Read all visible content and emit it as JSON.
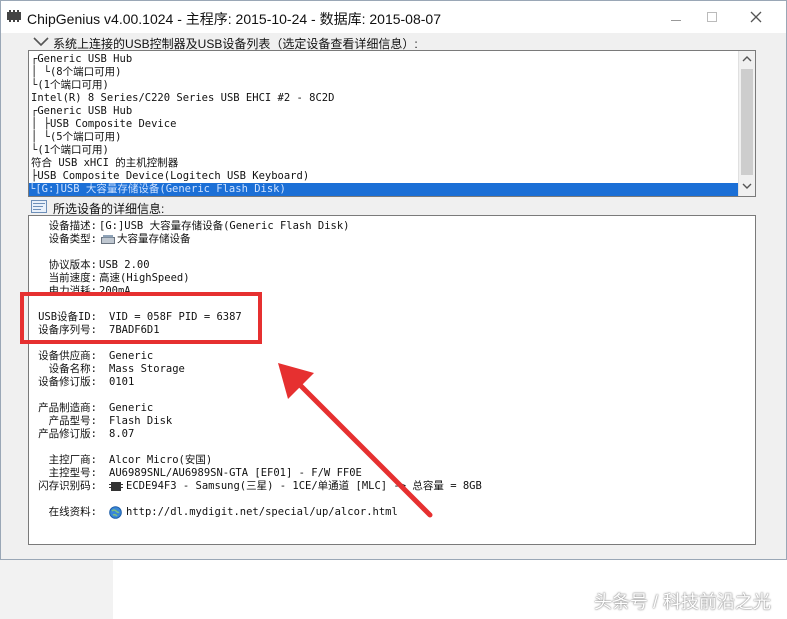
{
  "window": {
    "title": "ChipGenius v4.00.1024 - 主程序: 2015-10-24 - 数据库: 2015-08-07"
  },
  "device_list_section": {
    "label": "系统上连接的USB控制器及USB设备列表（选定设备查看详细信息）:",
    "items": [
      "┌Generic USB Hub",
      "│ └(8个端口可用)",
      "└(1个端口可用)",
      "Intel(R) 8 Series/C220 Series USB EHCI #2 - 8C2D",
      "┌Generic USB Hub",
      "│ ├USB Composite Device",
      "│ └(5个端口可用)",
      "└(1个端口可用)",
      "符合 USB xHCI 的主机控制器",
      "├USB Composite Device(Logitech USB Keyboard)",
      "└[G:]USB 大容量存储设备(Generic Flash Disk)"
    ],
    "selected_index": 10
  },
  "details_section": {
    "label": "所选设备的详细信息:",
    "rows": [
      {
        "label": "设备描述:",
        "value": "[G:]USB 大容量存储设备(Generic Flash Disk)"
      },
      {
        "label": "设备类型:",
        "value": "大容量存储设备"
      },
      {
        "label": "协议版本:",
        "value": "USB 2.00"
      },
      {
        "label": "当前速度:",
        "value": "高速(HighSpeed)"
      },
      {
        "label": "电力消耗:",
        "value": "200mA"
      },
      {
        "label": "USB设备ID:",
        "value": "VID = 058F PID = 6387"
      },
      {
        "label": "设备序列号:",
        "value": "7BADF6D1"
      },
      {
        "label": "设备供应商:",
        "value": "Generic"
      },
      {
        "label": "设备名称:",
        "value": "Mass Storage"
      },
      {
        "label": "设备修订版:",
        "value": "0101"
      },
      {
        "label": "产品制造商:",
        "value": "Generic"
      },
      {
        "label": "产品型号:",
        "value": "Flash Disk"
      },
      {
        "label": "产品修订版:",
        "value": "8.07"
      },
      {
        "label": "主控厂商:",
        "value": "Alcor Micro(安国)"
      },
      {
        "label": "主控型号:",
        "value": "AU6989SNL/AU6989SN-GTA [EF01] - F/W FF0E"
      },
      {
        "label": "闪存识别码:",
        "value": "ECDE94F3 - Samsung(三星) - 1CE/单通道 [MLC] -> 总容量 = 8GB"
      },
      {
        "label": "在线资料:",
        "value": "http://dl.mydigit.net/special/up/alcor.html"
      }
    ]
  },
  "watermark": "头条号 / 科技前沿之光",
  "colors": {
    "selection": "#1b6fd6",
    "highlight": "#e63030",
    "title_bg": "#ffffff",
    "window_bg": "#f0f0f0"
  },
  "icons": [
    "app-icon",
    "minimize-icon",
    "maximize-icon",
    "close-icon",
    "chevron-down-icon",
    "info-panel-icon",
    "drive-icon",
    "chip-icon",
    "globe-icon"
  ]
}
